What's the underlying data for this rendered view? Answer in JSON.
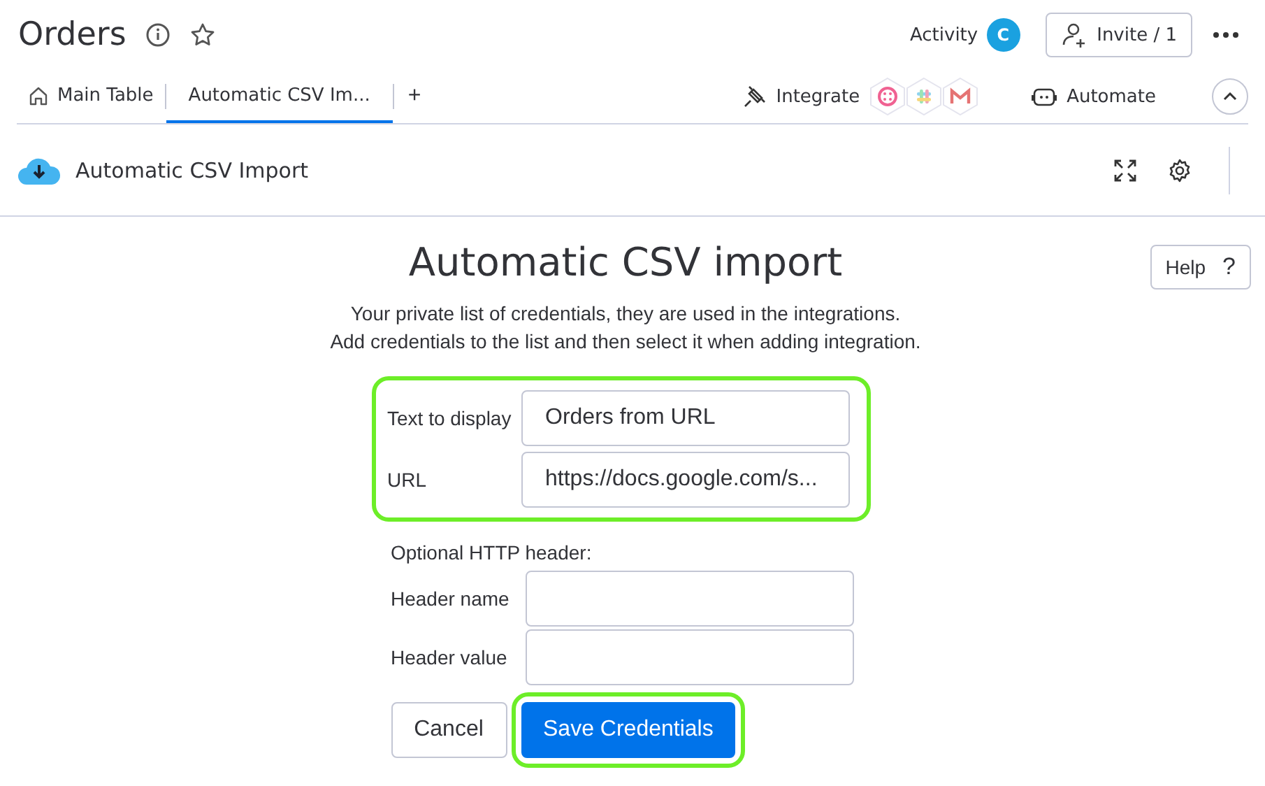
{
  "board": {
    "title": "Orders",
    "activity": "Activity",
    "avatar": "C",
    "invite": "Invite / 1"
  },
  "tabs": [
    {
      "label": "Main Table",
      "kind": "home",
      "selected": false
    },
    {
      "label": "Automatic CSV Im...",
      "kind": "plain",
      "selected": true
    }
  ],
  "add_tab": "+",
  "integrate": "Integrate",
  "automate": "Automate",
  "widget": {
    "title": "Automatic CSV Import"
  },
  "help": "Help",
  "help_icon": "?",
  "form": {
    "title": "Automatic CSV import",
    "intro": [
      "Your private list of credentials, they are used in the integrations.",
      "Add credentials to the list and then select it when adding integration."
    ],
    "main_fields": [
      {
        "label": "Text to display",
        "value": "Orders from URL"
      },
      {
        "label": "URL",
        "value": "https://docs.google.com/s..."
      }
    ],
    "main_highlighted": true,
    "optional_heading": "Optional HTTP header:",
    "header_fields": [
      {
        "label": "Header name"
      },
      {
        "label": "Header value"
      }
    ],
    "cancel": "Cancel",
    "save": "Save Credentials",
    "save_highlighted": true
  }
}
